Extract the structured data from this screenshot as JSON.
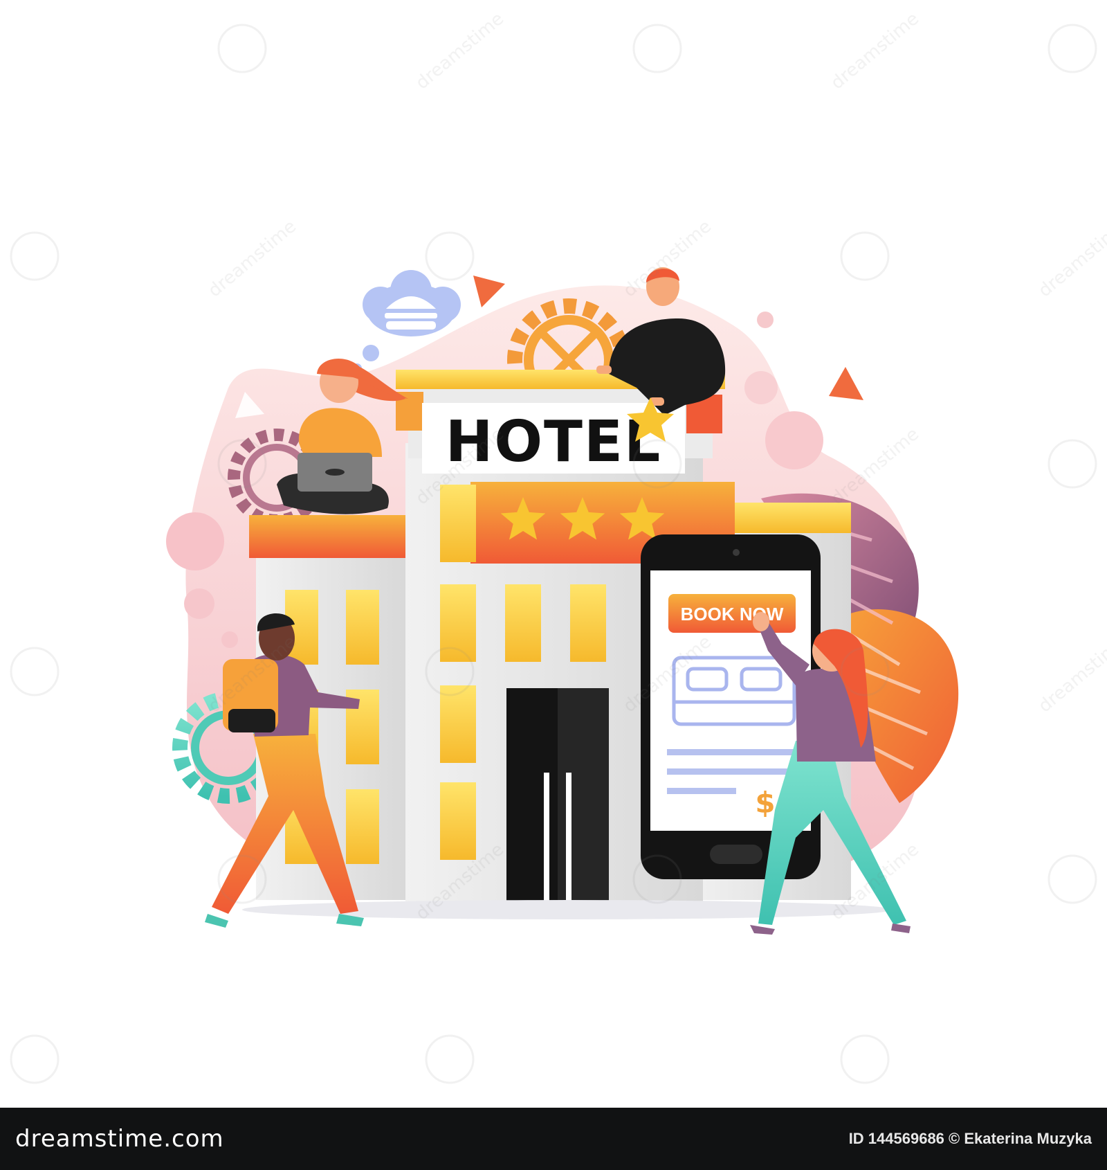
{
  "illustration": {
    "hotel_sign": "HOTEL",
    "rating_stars": 3,
    "book_button": "BOOK NOW",
    "price_symbol": "$"
  },
  "watermark": {
    "text": "dreamstime"
  },
  "footer": {
    "logo": "dreamstime.com",
    "credit": "ID 144569686 © Ekaterina Muzyka"
  },
  "colors": {
    "background": "#ffffff",
    "accent_orange": "#f05a36",
    "accent_yellow": "#f6c730",
    "blob_pink": "#f8d3d6",
    "footer_bg": "#111213"
  }
}
